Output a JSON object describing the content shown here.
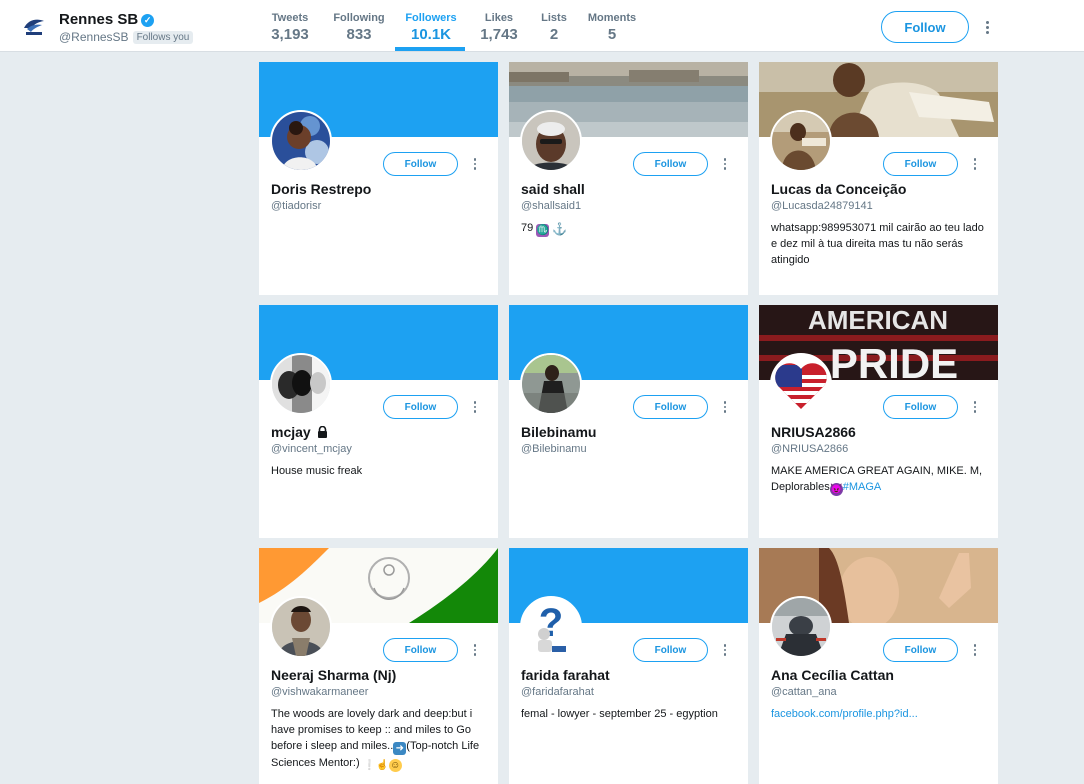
{
  "profile": {
    "name": "Rennes SB",
    "handle": "@RennesSB",
    "follows_you": "Follows you",
    "verified_icon": "verified-badge-icon"
  },
  "stats": [
    {
      "label": "Tweets",
      "value": "3,193"
    },
    {
      "label": "Following",
      "value": "833"
    },
    {
      "label": "Followers",
      "value": "10.1K"
    },
    {
      "label": "Likes",
      "value": "1,743"
    },
    {
      "label": "Lists",
      "value": "2"
    },
    {
      "label": "Moments",
      "value": "5"
    }
  ],
  "follow_label": "Follow",
  "colors": {
    "accent": "#1da1f2",
    "background": "#e6ecf0",
    "text_secondary": "#657786"
  },
  "cards": [
    {
      "name": "Doris Restrepo",
      "handle": "@tiadorisr",
      "bio": ""
    },
    {
      "name": "said shall",
      "handle": "@shallsaid1",
      "bio": "79",
      "bio_icons": [
        "scorpius-icon",
        "anchor-icon"
      ]
    },
    {
      "name": "Lucas da Conceição",
      "handle": "@Lucasda24879141",
      "bio": "whatsapp:989953071 mil cairão ao teu lado e dez mil à tua direita mas tu não serás atingido"
    },
    {
      "name": "mcjay",
      "name_icon": "lock-icon",
      "handle": "@vincent_mcjay",
      "bio": "House music freak"
    },
    {
      "name": "Bilebinamu",
      "handle": "@Bilebinamu",
      "bio": ""
    },
    {
      "name": "NRIUSA2866",
      "handle": "@NRIUSA2866",
      "bio": "MAKE AMERICA GREAT AGAIN, MIKE. M, Deplorables",
      "bio_link": "#MAGA",
      "bio_icons": [
        "devil-emoji-icon"
      ],
      "banner_text_1": "AMERICAN",
      "banner_text_2": "PRIDE"
    },
    {
      "name": "Neeraj Sharma (Nj)",
      "handle": "@vishwakarmaneer",
      "bio": "The woods are lovely dark and deep:but i have promises to keep :: and miles to Go before i sleep and miles..",
      "bio_tail": "(Top-notch Life Sciences Mentor:)",
      "bio_icons": [
        "arrow-right-emoji-icon",
        "exclamation-emoji-icon",
        "point-up-emoji-icon",
        "smile-emoji-icon"
      ]
    },
    {
      "name": "farida farahat",
      "handle": "@faridafarahat",
      "bio": "femal - lowyer - september 25 - egyption"
    },
    {
      "name": "Ana Cecília Cattan",
      "handle": "@cattan_ana",
      "bio": "",
      "bio_link": "facebook.com/profile.php?id..."
    }
  ]
}
